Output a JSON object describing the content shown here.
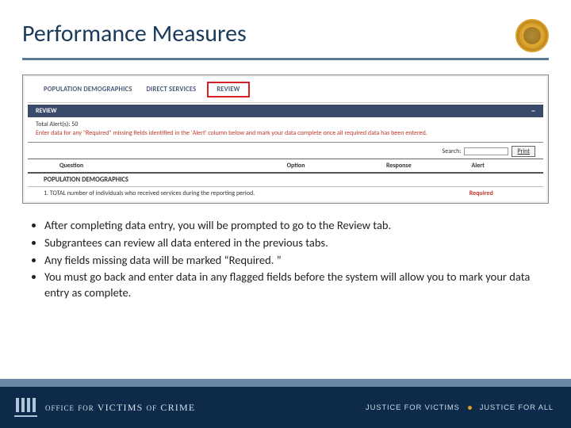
{
  "title": "Performance Measures",
  "screenshot": {
    "tabs": [
      "POPULATION DEMOGRAPHICS",
      "DIRECT SERVICES",
      "REVIEW"
    ],
    "review_bar": "REVIEW",
    "total_alert": "Total Alert(s): 50",
    "instruction": "Enter data for any \"Required\" missing fields identified in the 'Alert' column below and mark your data complete once all required data has been entered.",
    "search_label": "Search:",
    "print_label": "Print",
    "columns": [
      "Question",
      "Option",
      "Response",
      "Alert"
    ],
    "section": "POPULATION DEMOGRAPHICS",
    "q1": "1. TOTAL number of individuals who received services during the reporting period.",
    "q1_alert": "Required"
  },
  "bullets": [
    "After completing data entry, you will be prompted to go to the Review tab.",
    "Subgrantees can review all data entered in the previous tabs.",
    "Any fields missing data will be marked “Required. ”",
    "You must go back and enter data in any flagged fields before the system will allow you to mark your data entry as complete."
  ],
  "footer": {
    "org_small1": "OFFICE",
    "org_for": "FOR",
    "org_big": "VICTIMS",
    "org_of": "OF",
    "org_crime": "CRIME",
    "tag1": "JUSTICE FOR VICTIMS",
    "tag2": "JUSTICE FOR ALL"
  }
}
